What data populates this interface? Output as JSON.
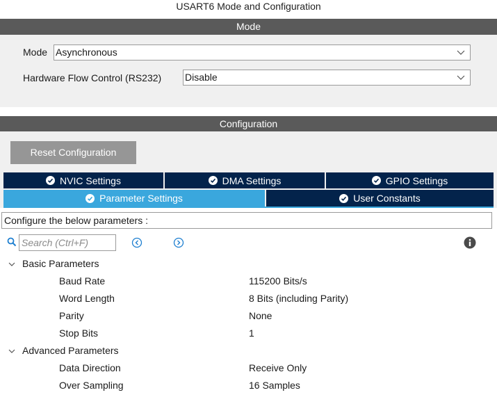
{
  "window_title": "USART6 Mode and Configuration",
  "mode_section": {
    "header": "Mode",
    "mode_label": "Mode",
    "mode_value": "Asynchronous",
    "flow_label": "Hardware Flow Control (RS232)",
    "flow_value": "Disable"
  },
  "config_section": {
    "header": "Configuration",
    "reset_label": "Reset Configuration",
    "tabs_row1": [
      {
        "label": "NVIC Settings"
      },
      {
        "label": "DMA Settings"
      },
      {
        "label": "GPIO Settings"
      }
    ],
    "tabs_row2": [
      {
        "label": "Parameter Settings",
        "active": true
      },
      {
        "label": "User Constants"
      }
    ]
  },
  "params": {
    "description": "Configure the below parameters :",
    "search_placeholder": "Search (Ctrl+F)",
    "groups": [
      {
        "name": "Basic Parameters",
        "items": [
          {
            "name": "Baud Rate",
            "value": "115200 Bits/s"
          },
          {
            "name": "Word Length",
            "value": "8 Bits (including Parity)"
          },
          {
            "name": "Parity",
            "value": "None"
          },
          {
            "name": "Stop Bits",
            "value": "1"
          }
        ]
      },
      {
        "name": "Advanced Parameters",
        "items": [
          {
            "name": "Data Direction",
            "value": "Receive Only"
          },
          {
            "name": "Over Sampling",
            "value": "16 Samples"
          }
        ]
      }
    ]
  },
  "colors": {
    "section_bar": "#5a5a5a",
    "tab_dark": "#03234b",
    "tab_active": "#3aa7dd",
    "reset_button": "#969696"
  },
  "icons": [
    "chevron-down-icon",
    "check-circle-icon",
    "search-icon",
    "previous-icon",
    "next-icon",
    "info-icon",
    "collapse-icon"
  ]
}
